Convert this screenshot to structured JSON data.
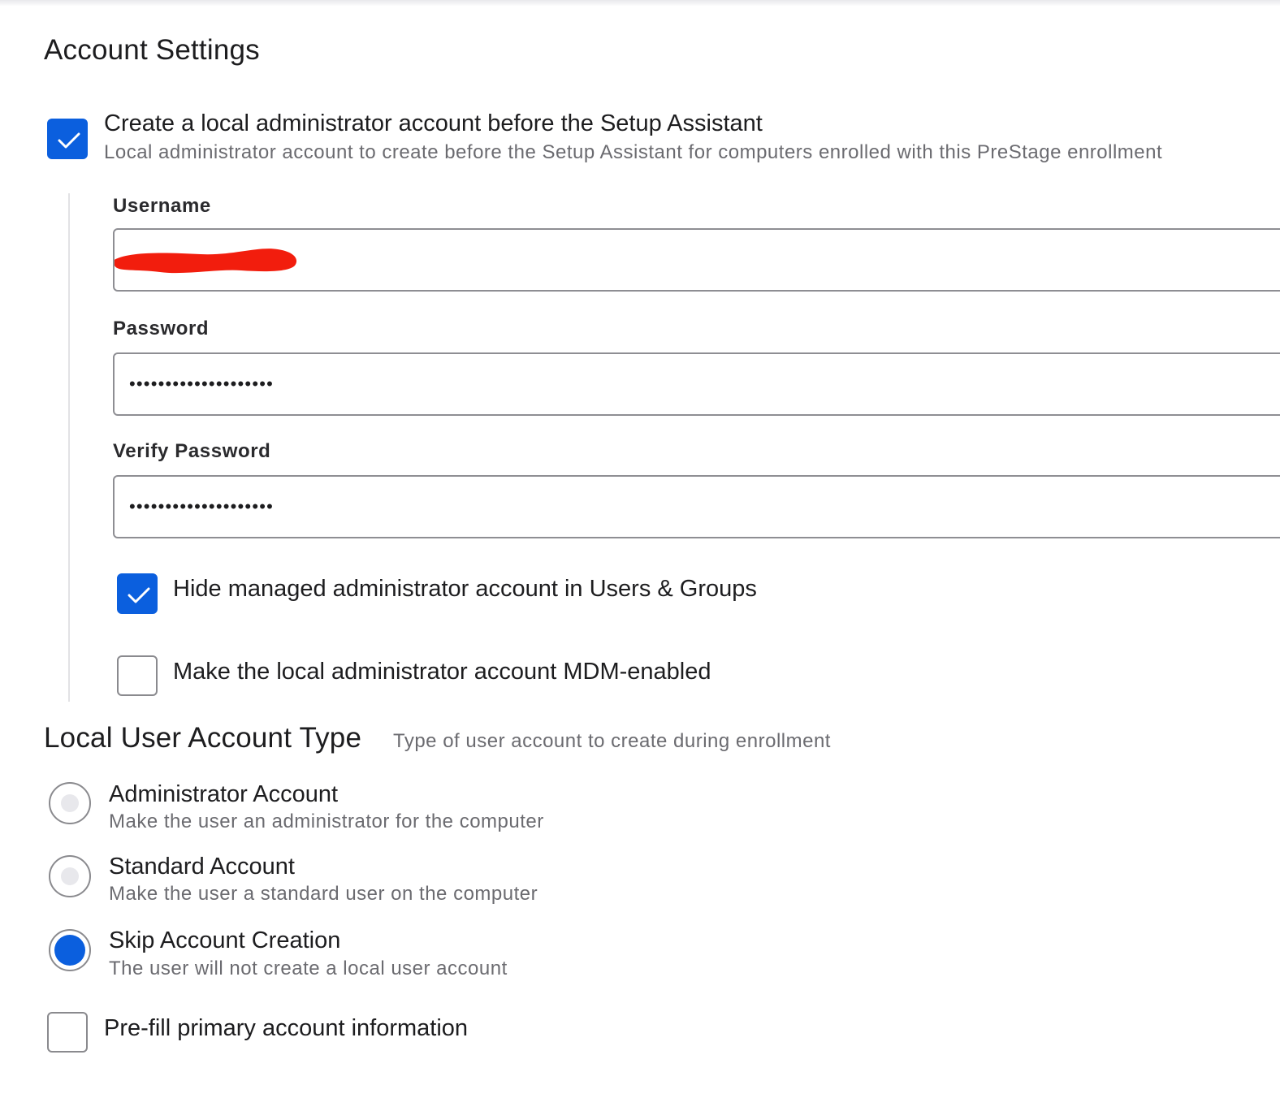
{
  "account_settings": {
    "title": "Account Settings",
    "create_admin": {
      "checked": true,
      "label": "Create a local administrator account before the Setup Assistant",
      "description": "Local administrator account to create before the Setup Assistant for computers enrolled with this PreStage enrollment"
    },
    "username": {
      "label": "Username",
      "value": ""
    },
    "password": {
      "label": "Password",
      "value": "••••••••••••••••••••"
    },
    "verify_password": {
      "label": "Verify Password",
      "value": "••••••••••••••••••••"
    },
    "hide_admin": {
      "checked": true,
      "label": "Hide managed administrator account in Users & Groups"
    },
    "mdm_enabled": {
      "checked": false,
      "label": "Make the local administrator account MDM-enabled"
    }
  },
  "local_user_account_type": {
    "title": "Local User Account Type",
    "description": "Type of user account to create during enrollment",
    "options": [
      {
        "label": "Administrator Account",
        "description": "Make the user an administrator for the computer",
        "selected": false
      },
      {
        "label": "Standard Account",
        "description": "Make the user a standard user on the computer",
        "selected": false
      },
      {
        "label": "Skip Account Creation",
        "description": "The user will not create a local user account",
        "selected": true
      }
    ],
    "prefill": {
      "checked": false,
      "label": "Pre-fill primary account information"
    }
  },
  "colors": {
    "accent": "#0b5fde",
    "redaction": "#f21d0d"
  }
}
